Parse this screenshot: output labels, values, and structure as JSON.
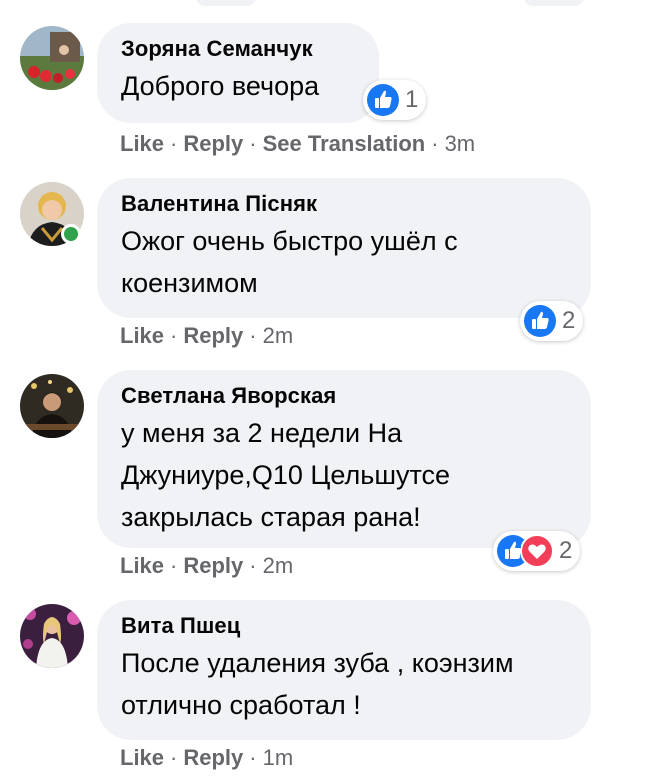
{
  "comments": [
    {
      "author": "Зоряна Семанчук",
      "text": "Доброго вечора",
      "reactions": [
        "like-icon"
      ],
      "reaction_count": "1",
      "actions": {
        "like": "Like",
        "reply": "Reply",
        "see_translation": "See Translation",
        "time": "3m"
      },
      "online": false
    },
    {
      "author": "Валентина Пісняк",
      "text": "Ожог очень быстро ушёл с коензимом",
      "reactions": [
        "like-icon"
      ],
      "reaction_count": "2",
      "actions": {
        "like": "Like",
        "reply": "Reply",
        "time": "2m"
      },
      "online": true
    },
    {
      "author": "Светлана Яворская",
      "text": "у меня за 2 недели На Джуниуре,Q10 Цельшутсе закрылась старая рана!",
      "reactions": [
        "like-icon",
        "love-icon"
      ],
      "reaction_count": "2",
      "actions": {
        "like": "Like",
        "reply": "Reply",
        "time": "2m"
      },
      "online": false
    },
    {
      "author": "Вита Пшец",
      "text": "После удаления зуба , коэнзим отлично сработал !",
      "actions": {
        "like": "Like",
        "reply": "Reply",
        "time": "1m"
      },
      "online": false
    }
  ],
  "separator": "·",
  "colors": {
    "bubble": "#f0f2f5",
    "meta_text": "#65676b",
    "like_blue": "#1877f2",
    "love_red": "#f33e58",
    "online_green": "#31a24c"
  }
}
